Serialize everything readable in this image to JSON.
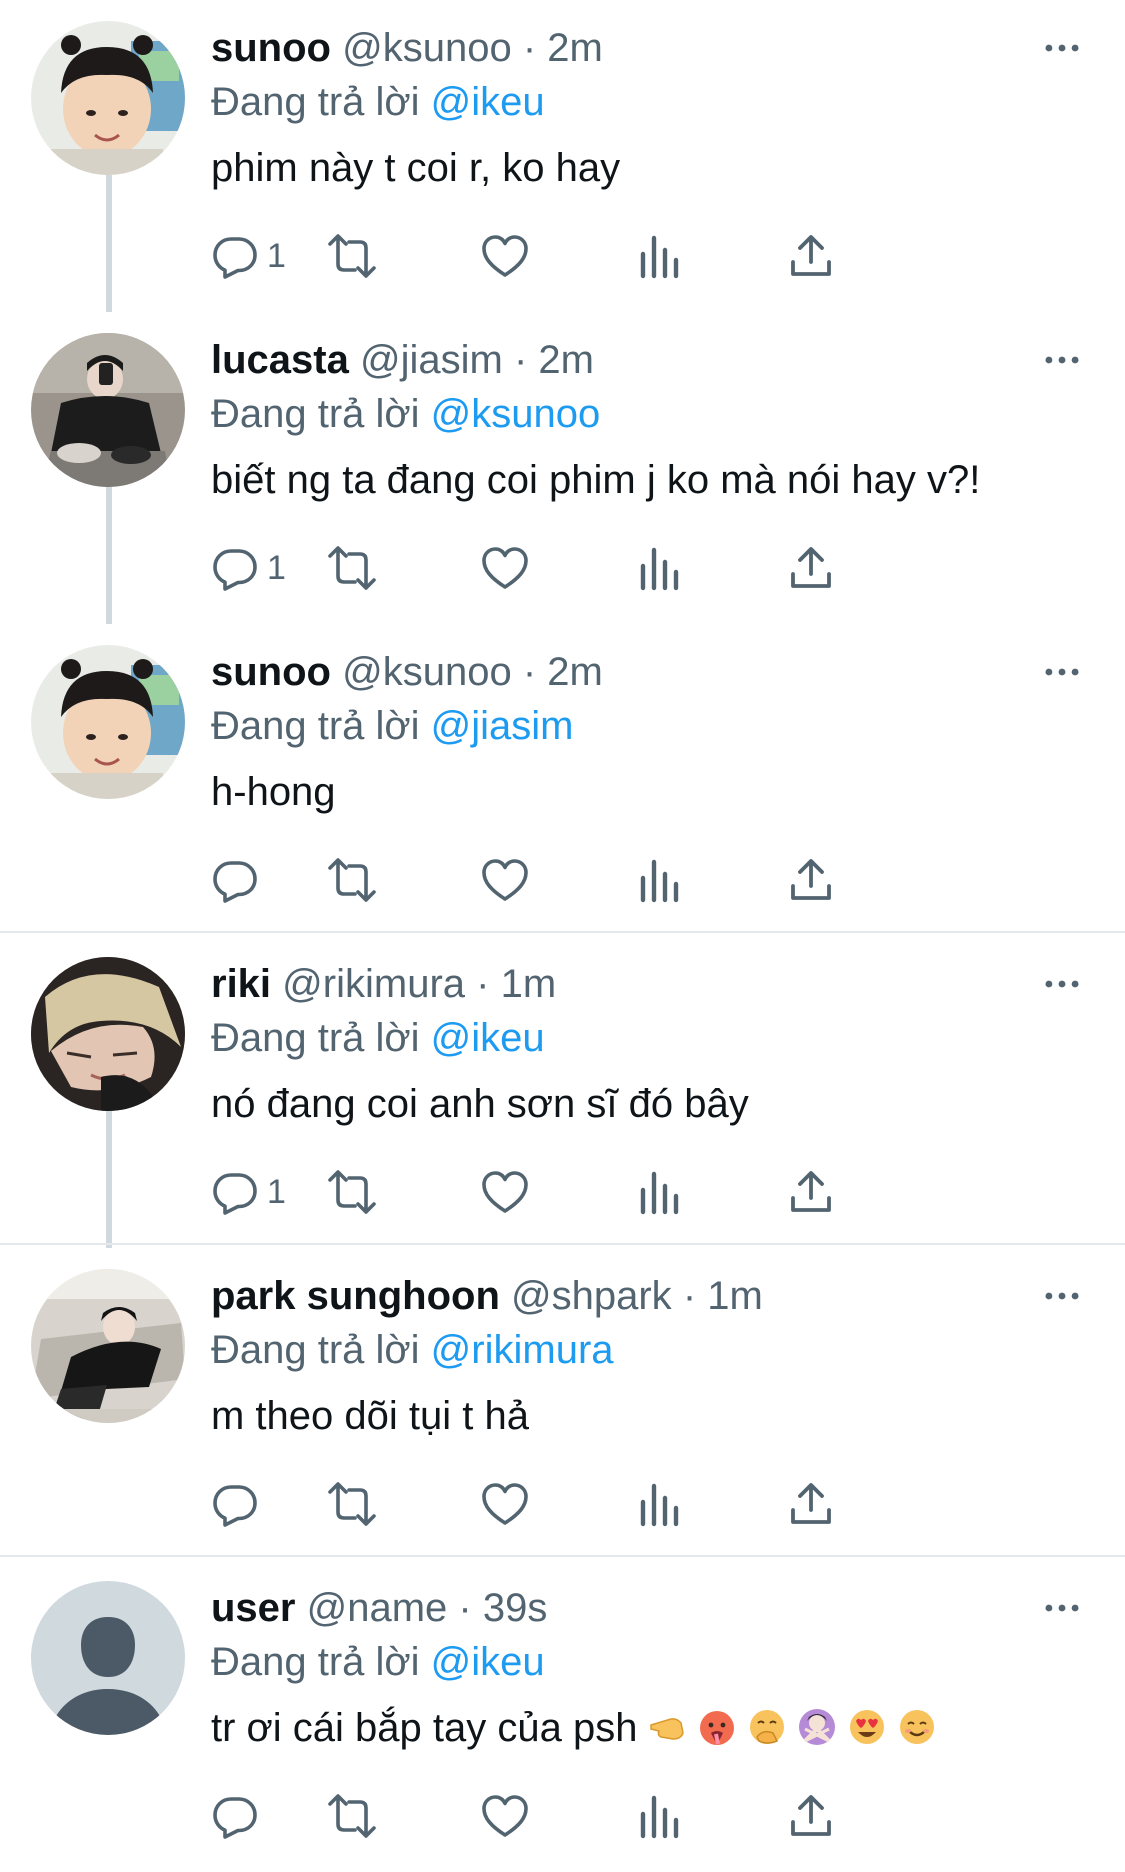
{
  "colors": {
    "text": "#0f1419",
    "secondary": "#536471",
    "accent": "#1d9bf0",
    "thread_line": "#cfd9de",
    "divider": "#e4e8eb"
  },
  "icons": {
    "reply": "reply-icon",
    "retweet": "retweet-icon",
    "like": "like-icon",
    "views": "views-icon",
    "share": "share-icon",
    "more": "more-icon"
  },
  "tweets": [
    {
      "name": "sunoo",
      "handle": "@ksunoo",
      "dot": "·",
      "time": "2m",
      "replying_prefix": "Đang trả lời",
      "replying_to": "@ikeu",
      "text": "phim này t coi r, ko hay",
      "reply_count": "1",
      "avatar": "child-photo"
    },
    {
      "name": "lucasta",
      "handle": "@jiasim",
      "dot": "·",
      "time": "2m",
      "replying_prefix": "Đang trả lời",
      "replying_to": "@ksunoo",
      "text": "biết ng ta đang coi phim j ko mà nói hay v?!",
      "reply_count": "1",
      "avatar": "mirror-selfie-photo"
    },
    {
      "name": "sunoo",
      "handle": "@ksunoo",
      "dot": "·",
      "time": "2m",
      "replying_prefix": "Đang trả lời",
      "replying_to": "@jiasim",
      "text": "h-hong",
      "reply_count": "",
      "avatar": "child-photo"
    },
    {
      "name": "riki",
      "handle": "@rikimura",
      "dot": "·",
      "time": "1m",
      "replying_prefix": "Đang trả lời",
      "replying_to": "@ikeu",
      "text": "nó đang coi anh sơn sĩ đó bây",
      "reply_count": "1",
      "avatar": "blond-hair-photo"
    },
    {
      "name": "park sunghoon",
      "handle": "@shpark",
      "dot": "·",
      "time": "1m",
      "replying_prefix": "Đang trả lời",
      "replying_to": "@rikimura",
      "text": "m theo dõi tụi t hả",
      "reply_count": "",
      "avatar": "leather-jacket-photo"
    },
    {
      "name": "user",
      "handle": "@name",
      "dot": "·",
      "time": "39s",
      "replying_prefix": "Đang trả lời",
      "replying_to": "@ikeu",
      "text": "tr ơi cái bắp tay của psh",
      "reply_count": "",
      "avatar": "default-avatar",
      "emojis": [
        "backhand-index-pointing-left-emoji",
        "hot-face-emoji",
        "face-with-hand-over-mouth-emoji",
        "person-gesturing-no-emoji",
        "heart-eyes-emoji",
        "smiling-face-emoji"
      ]
    }
  ]
}
